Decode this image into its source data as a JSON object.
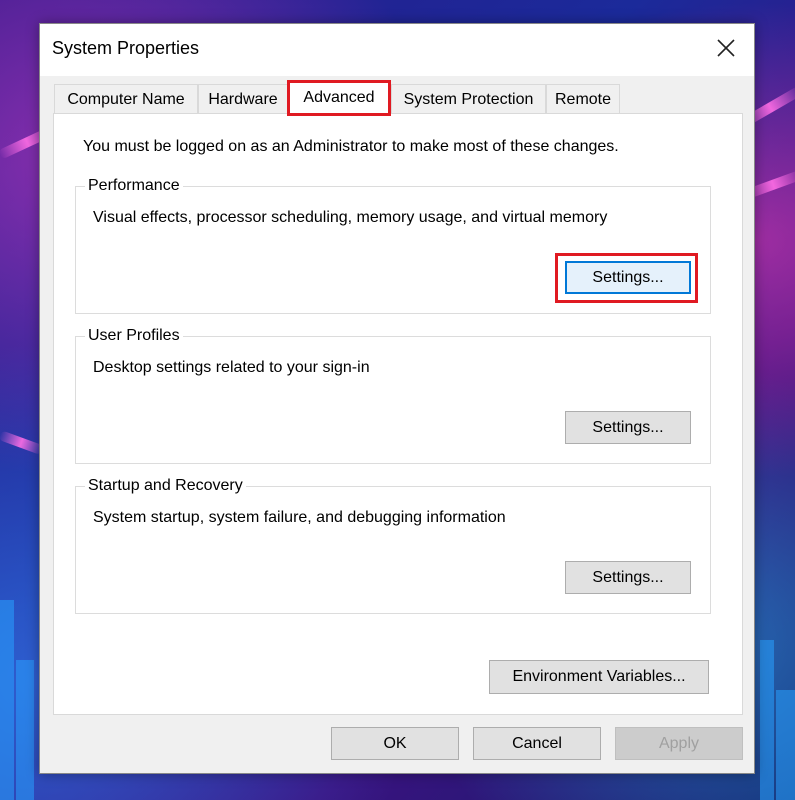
{
  "colors": {
    "accent_red": "#e01a22",
    "focus_blue": "#0078d7",
    "dialog_bg": "#f0f0f0"
  },
  "dialog": {
    "title": "System Properties",
    "close_icon": "close-icon"
  },
  "tabs": [
    {
      "label": "Computer Name"
    },
    {
      "label": "Hardware"
    },
    {
      "label": "Advanced",
      "selected": true
    },
    {
      "label": "System Protection"
    },
    {
      "label": "Remote"
    }
  ],
  "advanced": {
    "admin_note": "You must be logged on as an Administrator to make most of these changes.",
    "performance": {
      "title": "Performance",
      "description": "Visual effects, processor scheduling, memory usage, and virtual memory",
      "button": "Settings..."
    },
    "user_profiles": {
      "title": "User Profiles",
      "description": "Desktop settings related to your sign-in",
      "button": "Settings..."
    },
    "startup_recovery": {
      "title": "Startup and Recovery",
      "description": "System startup, system failure, and debugging information",
      "button": "Settings..."
    },
    "environment_variables": "Environment Variables..."
  },
  "footer": {
    "ok": "OK",
    "cancel": "Cancel",
    "apply": "Apply"
  }
}
